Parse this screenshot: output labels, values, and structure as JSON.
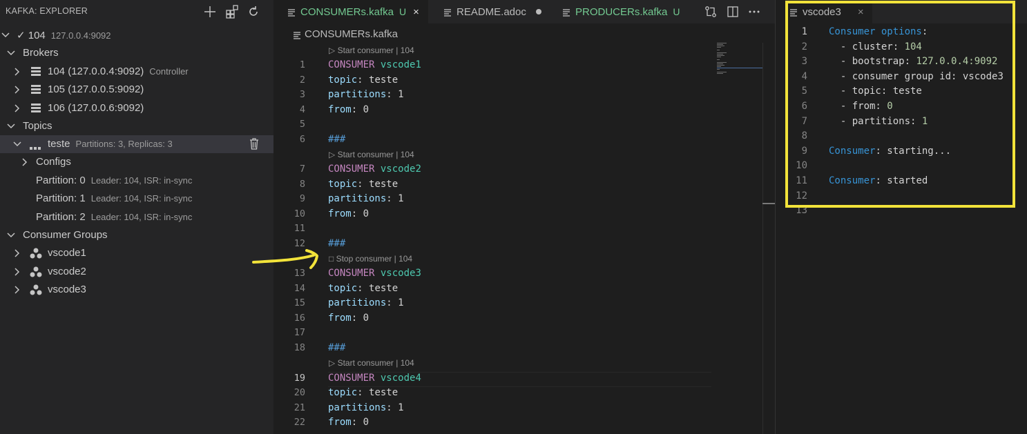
{
  "sidebar": {
    "title": "KAFKA: EXPLORER",
    "cluster": {
      "label": "✓ 104",
      "desc": "127.0.0.4:9092"
    },
    "brokers_label": "Brokers",
    "brokers": [
      {
        "label": "104 (127.0.0.4:9092)",
        "desc": "Controller"
      },
      {
        "label": "105 (127.0.0.5:9092)",
        "desc": ""
      },
      {
        "label": "106 (127.0.0.6:9092)",
        "desc": ""
      }
    ],
    "topics_label": "Topics",
    "topic": {
      "label": "teste",
      "desc": "Partitions: 3, Replicas: 3"
    },
    "configs_label": "Configs",
    "partitions": [
      {
        "label": "Partition: 0",
        "desc": "Leader: 104, ISR: in-sync"
      },
      {
        "label": "Partition: 1",
        "desc": "Leader: 104, ISR: in-sync"
      },
      {
        "label": "Partition: 2",
        "desc": "Leader: 104, ISR: in-sync"
      }
    ],
    "groups_label": "Consumer Groups",
    "groups": [
      "vscode1",
      "vscode2",
      "vscode3"
    ]
  },
  "editor1": {
    "tabs": [
      {
        "label": "CONSUMERs.kafka",
        "badge": "U",
        "close": "×"
      },
      {
        "label": "README.adoc"
      },
      {
        "label": "PRODUCERs.kafka",
        "badge": "U"
      }
    ],
    "breadcrumb": "CONSUMERs.kafka",
    "lens": [
      "▷ Start consumer | 104",
      "▷ Start consumer | 104",
      "□ Stop consumer | 104",
      "▷ Start consumer | 104"
    ],
    "line_numbers": [
      "1",
      "2",
      "3",
      "4",
      "5",
      "6",
      "7",
      "8",
      "9",
      "10",
      "11",
      "12",
      "13",
      "14",
      "15",
      "16",
      "17",
      "18",
      "19",
      "20",
      "21",
      "22"
    ],
    "keywords": {
      "consumer": "CONSUMER",
      "topic": "topic",
      "partitions": "partitions",
      "from": "from",
      "separator": "###"
    },
    "blocks": [
      {
        "name": "vscode1",
        "topic": "teste",
        "partitions": "1",
        "from": "0"
      },
      {
        "name": "vscode2",
        "topic": "teste",
        "partitions": "1",
        "from": "0"
      },
      {
        "name": "vscode3",
        "topic": "teste",
        "partitions": "1",
        "from": "0"
      },
      {
        "name": "vscode4",
        "topic": "teste",
        "partitions": "1",
        "from": "0"
      }
    ]
  },
  "editor2": {
    "tab": {
      "label": "vscode3",
      "close": "×"
    },
    "line_numbers": [
      "1",
      "2",
      "3",
      "4",
      "5",
      "6",
      "7",
      "8",
      "9",
      "10",
      "11",
      "12",
      "13"
    ],
    "lines": {
      "options_key": "Consumer options",
      "cluster_key": "  - cluster: ",
      "cluster_val": "104",
      "bootstrap_key": "  - bootstrap: ",
      "bootstrap_val": "127.0.0.4:9092",
      "group_key": "  - consumer group id: ",
      "group_val": "vscode3",
      "topic_key": "  - topic: ",
      "topic_val": "teste",
      "from_key": "  - from: ",
      "from_val": "0",
      "partitions_key": "  - partitions: ",
      "partitions_val": "1",
      "consumer_key": "Consumer",
      "starting": ": starting...",
      "started": ": started"
    }
  },
  "colors": {
    "highlight": "#f2e33a",
    "keyword": "#c586c0",
    "name": "#4ec9b0",
    "key": "#9cdcfe",
    "accent_blue": "#3794d6"
  }
}
